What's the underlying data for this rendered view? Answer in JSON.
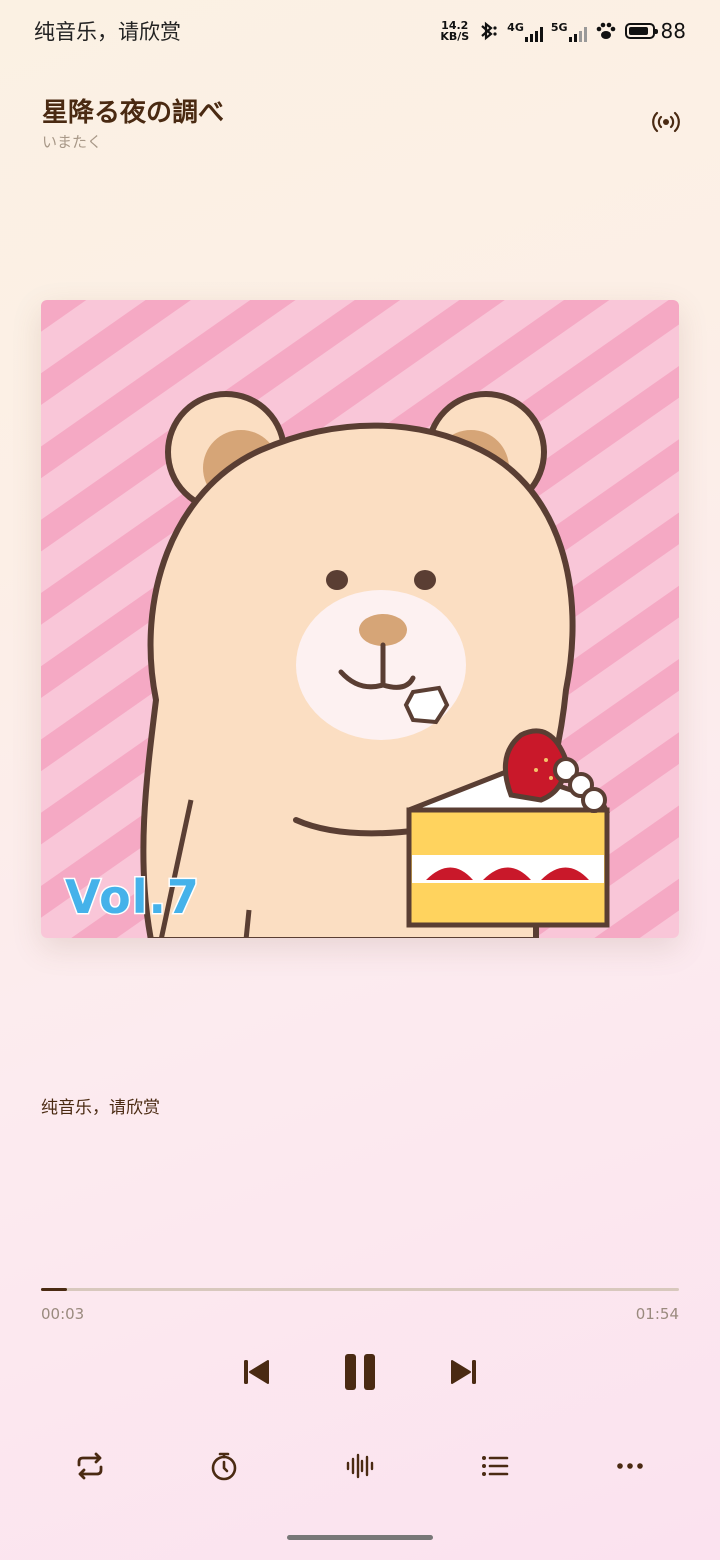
{
  "status_bar": {
    "notification_text": "纯音乐，请欣赏",
    "net_speed_value": "14.2",
    "net_speed_unit": "KB/S",
    "sim1_label": "4G",
    "sim2_label": "5G",
    "battery_level": "88"
  },
  "song": {
    "title": "星降る夜の調べ",
    "artist": "いまたく"
  },
  "cover": {
    "volume_label": "Vol.7",
    "colors": {
      "stripe_light": "#f9c6d8",
      "stripe_dark": "#f5a9c4",
      "bear": "#fbdec2",
      "outline": "#5a3e33"
    }
  },
  "lyric": {
    "current_line": "纯音乐，请欣赏"
  },
  "progress": {
    "current_time": "00:03",
    "total_time": "01:54",
    "fraction": 0.04
  },
  "controls": {
    "prev_icon": "skip-previous-icon",
    "play_state_icon": "pause-icon",
    "next_icon": "skip-next-icon"
  },
  "bottom_bar": {
    "icons": [
      "repeat-icon",
      "sleep-timer-icon",
      "audio-effect-icon",
      "playlist-icon",
      "more-icon"
    ]
  },
  "theme": {
    "accent": "#4a2a12",
    "secondary_text": "#9a8a7e"
  }
}
